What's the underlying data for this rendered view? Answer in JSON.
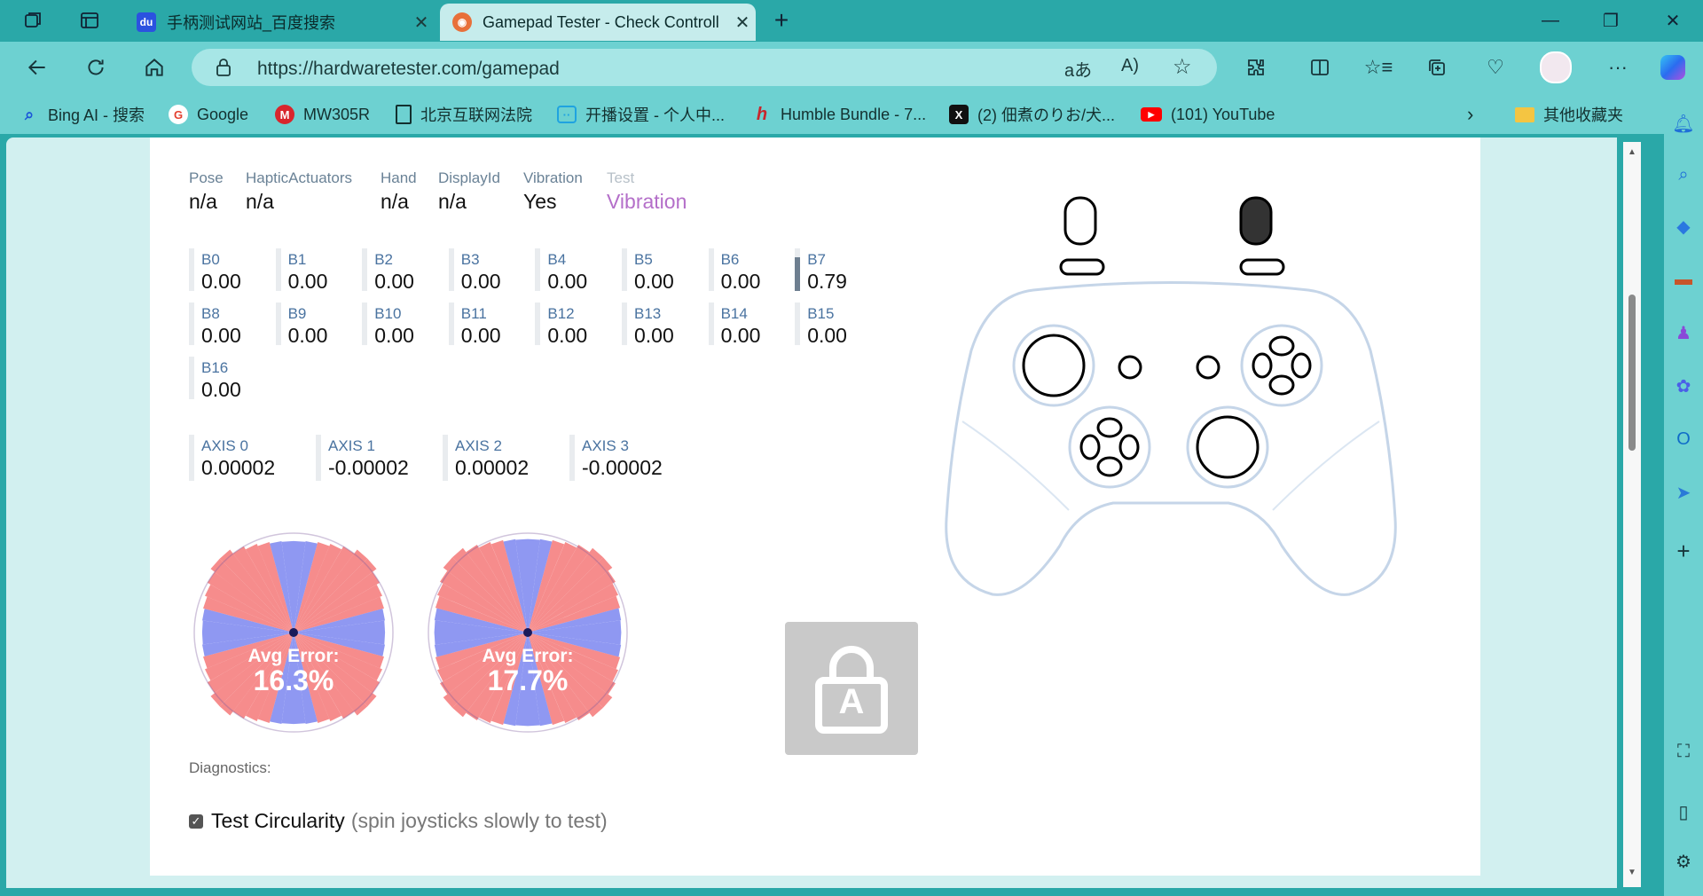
{
  "tabs": [
    {
      "title": "手柄测试网站_百度搜索",
      "favicon": "baidu-paw-icon"
    },
    {
      "title": "Gamepad Tester - Check Controll",
      "favicon": "gamepad-face-icon",
      "active": true
    }
  ],
  "address_bar": {
    "url": "https://hardwaretester.com/gamepad"
  },
  "bookmarks": [
    {
      "label": "Bing AI - 搜索",
      "icon": "search-icon"
    },
    {
      "label": "Google",
      "icon": "google-icon"
    },
    {
      "label": "MW305R",
      "icon": "mercury-icon"
    },
    {
      "label": "北京互联网法院",
      "icon": "document-icon"
    },
    {
      "label": "开播设置 - 个人中...",
      "icon": "bilibili-icon"
    },
    {
      "label": "Humble Bundle - 7...",
      "icon": "humble-icon"
    },
    {
      "label": "(2) 佃煮のりお/犬...",
      "icon": "x-icon"
    },
    {
      "label": "(101) YouTube",
      "icon": "youtube-icon"
    }
  ],
  "other_bookmarks": "其他收藏夹",
  "gamepad_info": {
    "headers": [
      "Pose",
      "HapticActuators",
      "Hand",
      "DisplayId",
      "Vibration",
      "Test"
    ],
    "values": [
      "n/a",
      "n/a",
      "n/a",
      "n/a",
      "Yes",
      "Vibration"
    ]
  },
  "buttons": [
    {
      "label": "B0",
      "value": "0.00",
      "level": 0
    },
    {
      "label": "B1",
      "value": "0.00",
      "level": 0
    },
    {
      "label": "B2",
      "value": "0.00",
      "level": 0
    },
    {
      "label": "B3",
      "value": "0.00",
      "level": 0
    },
    {
      "label": "B4",
      "value": "0.00",
      "level": 0
    },
    {
      "label": "B5",
      "value": "0.00",
      "level": 0
    },
    {
      "label": "B6",
      "value": "0.00",
      "level": 0
    },
    {
      "label": "B7",
      "value": "0.79",
      "level": 0.79
    },
    {
      "label": "B8",
      "value": "0.00",
      "level": 0
    },
    {
      "label": "B9",
      "value": "0.00",
      "level": 0
    },
    {
      "label": "B10",
      "value": "0.00",
      "level": 0
    },
    {
      "label": "B11",
      "value": "0.00",
      "level": 0
    },
    {
      "label": "B12",
      "value": "0.00",
      "level": 0
    },
    {
      "label": "B13",
      "value": "0.00",
      "level": 0
    },
    {
      "label": "B14",
      "value": "0.00",
      "level": 0
    },
    {
      "label": "B15",
      "value": "0.00",
      "level": 0
    },
    {
      "label": "B16",
      "value": "0.00",
      "level": 0
    }
  ],
  "axes": [
    {
      "label": "AXIS 0",
      "value": "0.00002"
    },
    {
      "label": "AXIS 1",
      "value": "-0.00002"
    },
    {
      "label": "AXIS 2",
      "value": "0.00002"
    },
    {
      "label": "AXIS 3",
      "value": "-0.00002"
    }
  ],
  "circularity": [
    {
      "caption": "Avg Error:",
      "value": "16.3%"
    },
    {
      "caption": "Avg Error:",
      "value": "17.7%"
    }
  ],
  "lock_button_letter": "A",
  "diagnostics_label": "Diagnostics:",
  "test_circularity": {
    "label": "Test Circularity",
    "hint": "(spin joysticks slowly to test)",
    "checked": true
  },
  "colors": {
    "frame": "#2aa8a8",
    "toolbar": "#6dd1d1",
    "address": "#a7e6e6",
    "accent_red": "#f47878",
    "accent_blue": "#7b86f0",
    "test_purple": "#b46fc9"
  }
}
